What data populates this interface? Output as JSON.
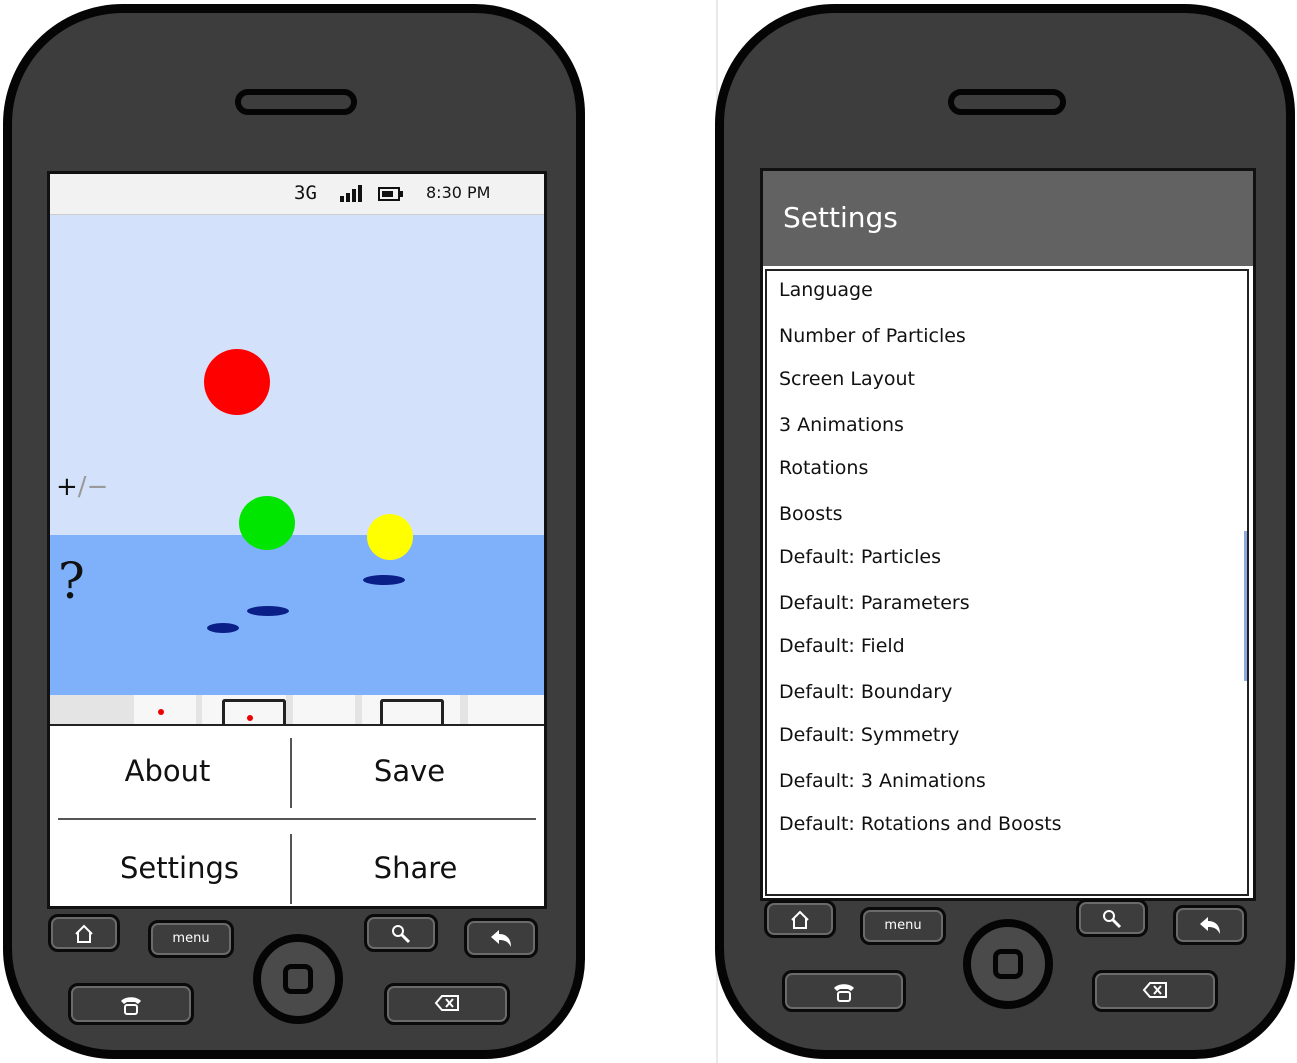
{
  "left_phone": {
    "status_bar": {
      "network": "3G",
      "time": "8:30 PM",
      "icons": [
        "signal-icon",
        "battery-icon"
      ]
    },
    "canvas": {
      "zoom_control": {
        "plus": "+",
        "slash": "/",
        "minus": "−"
      },
      "help_label": "?",
      "balls": [
        {
          "color": "#ff0000"
        },
        {
          "color": "#00e600"
        },
        {
          "color": "#ffff00"
        }
      ]
    },
    "options_menu": {
      "about": "About",
      "save": "Save",
      "settings": "Settings",
      "share": "Share"
    },
    "hardware": {
      "menu": "menu",
      "icons": [
        "home-icon",
        "search-icon",
        "back-icon",
        "phone-icon",
        "delete-icon"
      ]
    }
  },
  "right_phone": {
    "header": {
      "title": "Settings"
    },
    "settings_items": [
      "Language",
      "Number of Particles",
      "Screen Layout",
      "3 Animations",
      "Rotations",
      "Boosts",
      "Default: Particles",
      "Default: Parameters",
      "Default: Field",
      "Default: Boundary",
      "Default: Symmetry",
      "Default: 3 Animations",
      "Default: Rotations and Boosts"
    ],
    "hardware": {
      "menu": "menu"
    }
  },
  "colors": {
    "phone_body": "#3d3d3d",
    "sky": "#d3e2fa",
    "sea": "#7fb1fa",
    "settings_header": "#626262",
    "shadow": "#0b1f88"
  }
}
